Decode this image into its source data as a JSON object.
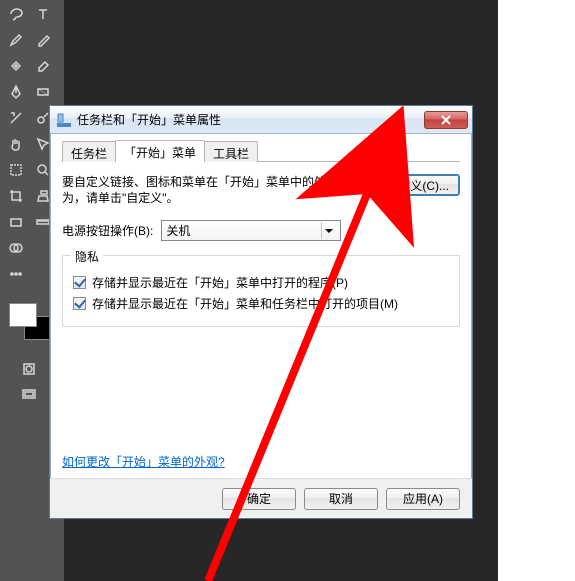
{
  "dialog": {
    "title": "任务栏和「开始」菜单属性",
    "tabs": [
      "任务栏",
      "「开始」菜单",
      "工具栏"
    ],
    "active_tab": 1,
    "desc": "要自定义链接、图标和菜单在「开始」菜单中的外观和行为，请单击\"自定义\"。",
    "customize_btn": "自定义(C)...",
    "power_label": "电源按钮操作(B):",
    "power_value": "关机",
    "privacy": {
      "title": "隐私",
      "opt1": "存储并显示最近在「开始」菜单中打开的程序(P)",
      "opt2": "存储并显示最近在「开始」菜单和任务栏中打开的项目(M)"
    },
    "help_link": "如何更改「开始」菜单的外观?",
    "buttons": {
      "ok": "确定",
      "cancel": "取消",
      "apply": "应用(A)"
    }
  },
  "tool_icons_col1": [
    "lasso",
    "brush",
    "spot-heal",
    "pen",
    "path",
    "hand",
    "rect-select",
    "crop",
    "slice",
    "union"
  ],
  "tool_icons_col2": [
    "text",
    "eyedropper",
    "eraser",
    "gradient",
    "dodge",
    "arrow",
    "zoom",
    "shape",
    "more"
  ]
}
